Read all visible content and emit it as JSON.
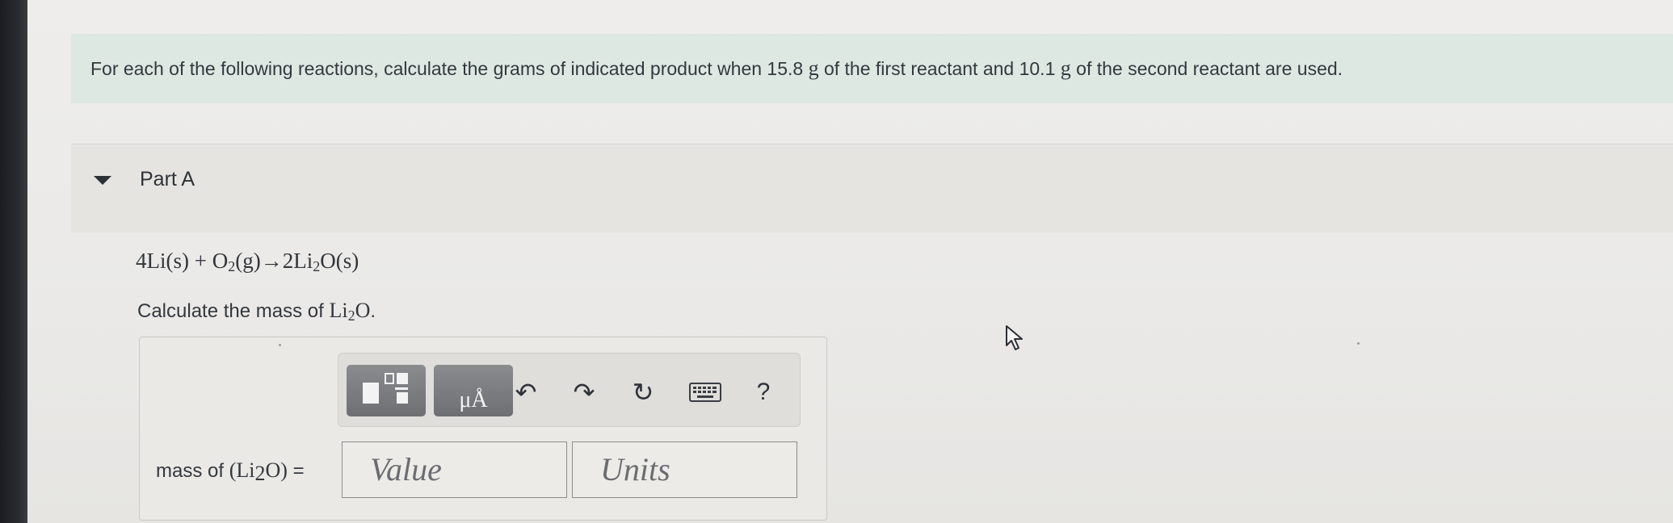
{
  "intro": {
    "text_before": "For each of the following reactions, calculate the grams of indicated product when 15.8 ",
    "unit1": "g",
    "text_middle": " of the first reactant and 10.1 ",
    "unit2": "g",
    "text_after": " of the second reactant are used."
  },
  "part": {
    "title": "Part A",
    "equation": {
      "a": "4Li(s) + O",
      "a_sub": "2",
      "b": "(g)→2Li",
      "b_sub": "2",
      "c": "O(s)"
    },
    "prompt": {
      "text": "Calculate the mass of ",
      "formula": "Li",
      "formula_sub": "2",
      "formula_end": "O",
      "period": "."
    }
  },
  "toolbar": {
    "units_glyph": "μÅ",
    "undo_icon": "↶",
    "redo_icon": "↷",
    "reset_icon": "↻",
    "help_label": "?"
  },
  "answer": {
    "label_text": "mass of ",
    "label_formula_open": "(Li",
    "label_formula_sub": "2",
    "label_formula_close": "O)",
    "label_equals": " =",
    "value_placeholder": "Value",
    "units_placeholder": "Units"
  },
  "icons": {
    "caret": "caret-down-icon",
    "template": "templates-icon",
    "units": "units-icon",
    "undo": "undo-icon",
    "redo": "redo-icon",
    "reset": "reset-icon",
    "keyboard": "keyboard-icon",
    "help": "help-icon",
    "cursor": "mouse-pointer-icon"
  },
  "colors": {
    "intro_bg": "#dde8e3",
    "tool_button": "#7a7c80",
    "text": "#34383d"
  }
}
